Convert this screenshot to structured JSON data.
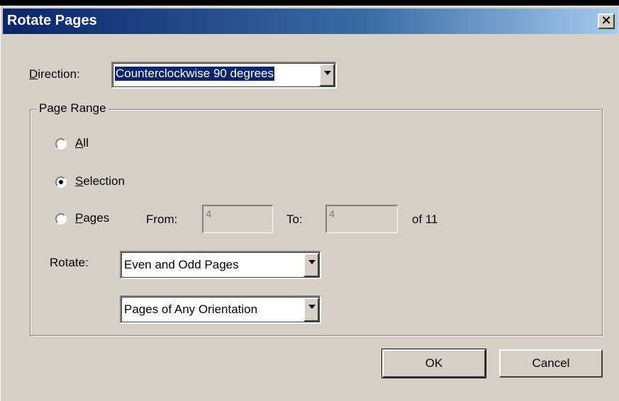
{
  "window": {
    "title": "Rotate Pages",
    "close_label": "×"
  },
  "direction": {
    "label": "Direction:",
    "value": "Counterclockwise 90 degrees"
  },
  "page_range": {
    "label": "Page Range",
    "all_label": "All",
    "selection_label": "Selection",
    "pages_label": "Pages",
    "selected": "selection",
    "from_label": "From:",
    "from_value": "4",
    "to_label": "To:",
    "to_value": "4",
    "of_text": "of 11"
  },
  "rotate": {
    "label": "Rotate:",
    "parity_value": "Even and Odd Pages",
    "orientation_value": "Pages of Any Orientation"
  },
  "buttons": {
    "ok": "OK",
    "cancel": "Cancel"
  }
}
